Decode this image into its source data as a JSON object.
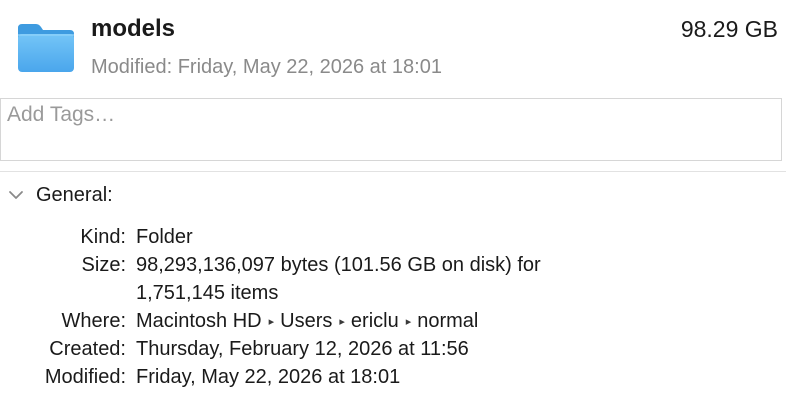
{
  "header": {
    "name": "models",
    "size": "98.29 GB",
    "modified": "Modified: Friday, May 22, 2026 at 18:01",
    "icon": "folder-icon",
    "icon_color": "#5DB6F2"
  },
  "tags": {
    "placeholder": "Add Tags…",
    "value": ""
  },
  "general": {
    "title": "General:",
    "kind": {
      "label": "Kind:",
      "value": "Folder"
    },
    "size": {
      "label": "Size:",
      "value_line1": "98,293,136,097 bytes (101.56 GB on disk) for",
      "value_line2": "1,751,145 items"
    },
    "where": {
      "label": "Where:",
      "path": [
        "Macintosh HD",
        "Users",
        "ericlu",
        "normal"
      ],
      "separator": "▸"
    },
    "created": {
      "label": "Created:",
      "value": "Thursday, February 12, 2026 at 11:56"
    },
    "modified": {
      "label": "Modified:",
      "value": "Friday, May 22, 2026 at 18:01"
    }
  }
}
